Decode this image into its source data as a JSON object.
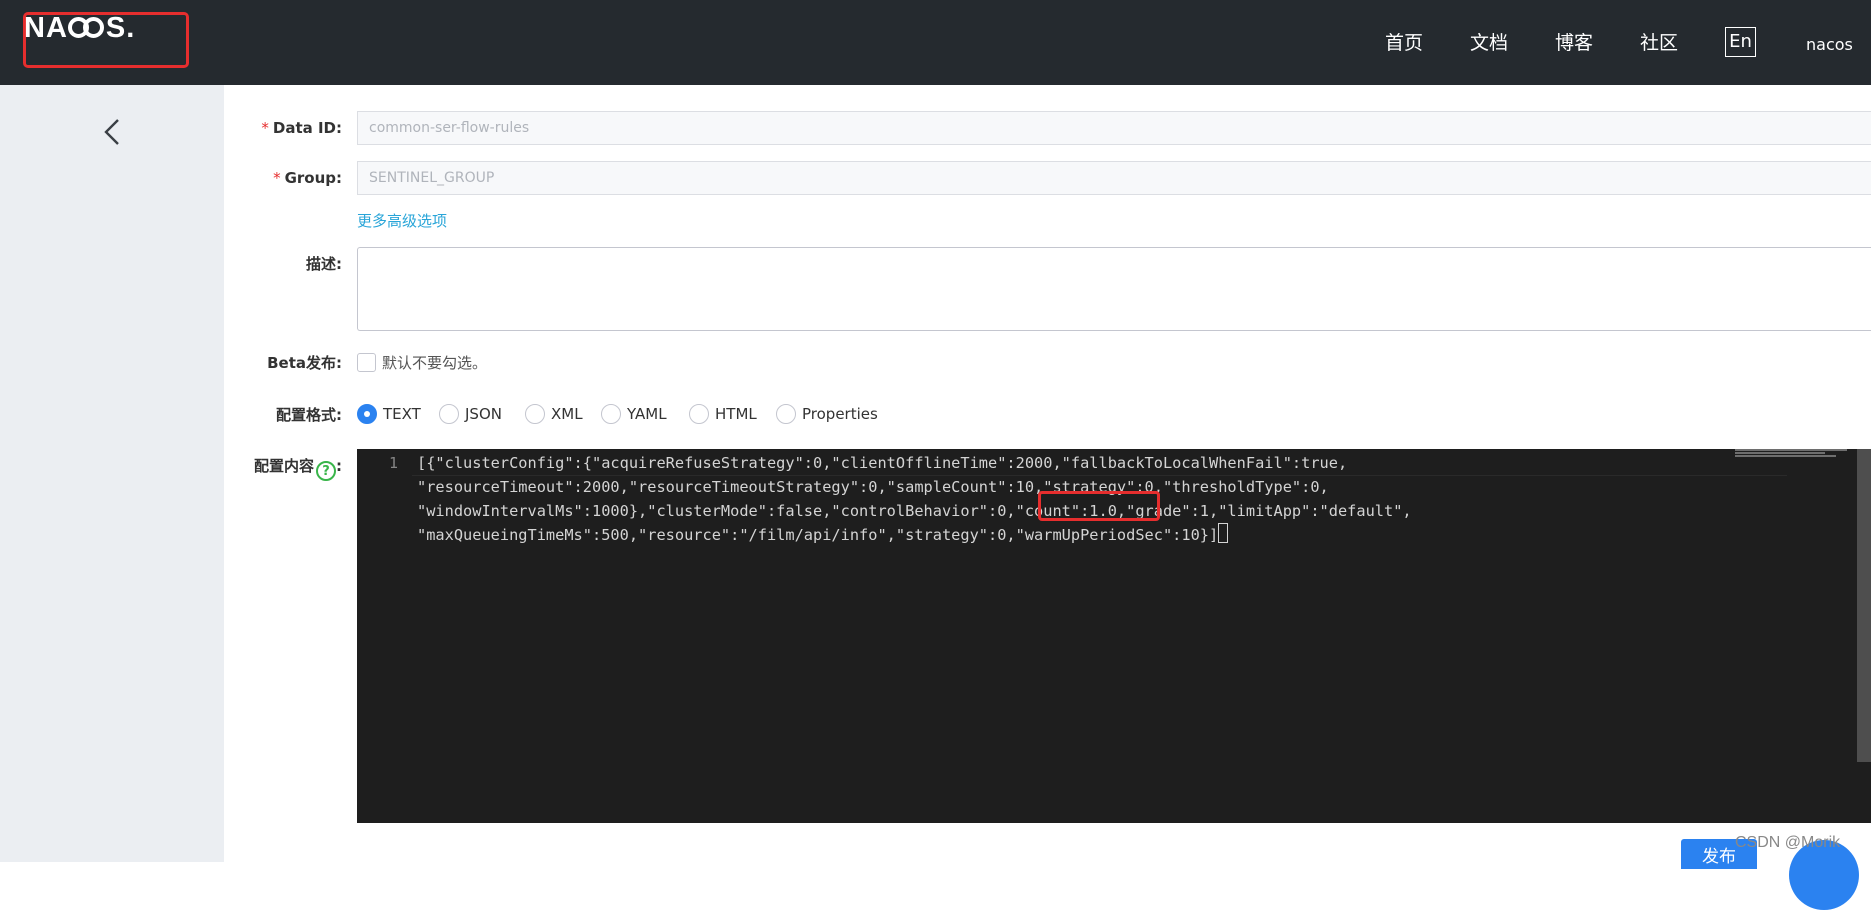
{
  "header": {
    "logo_text": "NACOS.",
    "nav": [
      "首页",
      "文档",
      "博客",
      "社区"
    ],
    "lang_button": "En",
    "user": "nacos"
  },
  "form": {
    "data_id_label": "Data ID:",
    "data_id_value": "common-ser-flow-rules",
    "group_label": "Group:",
    "group_value": "SENTINEL_GROUP",
    "advanced_link": "更多高级选项",
    "desc_label": "描述:",
    "beta_label": "Beta发布:",
    "beta_hint": "默认不要勾选。",
    "format_label": "配置格式:",
    "formats": [
      "TEXT",
      "JSON",
      "XML",
      "YAML",
      "HTML",
      "Properties"
    ],
    "selected_format": "TEXT",
    "content_label": "配置内容",
    "content_colon": ":"
  },
  "editor": {
    "line_number": "1",
    "lines": [
      "[{\"clusterConfig\":{\"acquireRefuseStrategy\":0,\"clientOfflineTime\":2000,\"fallbackToLocalWhenFail\":true,",
      "\"resourceTimeout\":2000,\"resourceTimeoutStrategy\":0,\"sampleCount\":10,\"strategy\":0,\"thresholdType\":0,",
      "\"windowIntervalMs\":1000},\"clusterMode\":false,\"controlBehavior\":0,\"count\":1.0,\"grade\":1,\"limitApp\":\"default\",",
      "\"maxQueueingTimeMs\":500,\"resource\":\"/film/api/info\",\"strategy\":0,\"warmUpPeriodSec\":10}]"
    ]
  },
  "footer": {
    "publish_button": "发布",
    "watermark": "CSDN @Morik"
  },
  "colors": {
    "header_bg": "#252a2f",
    "sidebar_bg": "#ebeef2",
    "accent": "#2b82f0",
    "annotation_red": "#e62e2e",
    "link": "#29a5d8"
  }
}
